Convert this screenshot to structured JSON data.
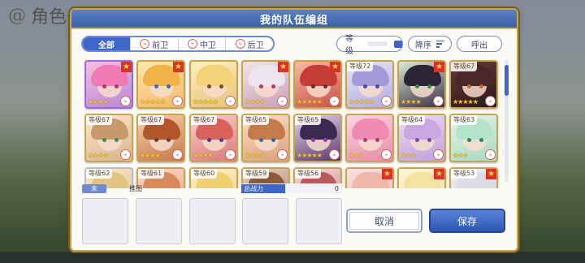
{
  "background": {
    "screen_title": "角色一览"
  },
  "dialog": {
    "title": "我的队伍编组"
  },
  "filter_tabs": [
    {
      "label": "全部",
      "icon": "",
      "active": true
    },
    {
      "label": "前卫",
      "icon": "front-position-icon",
      "active": false
    },
    {
      "label": "中卫",
      "icon": "middle-position-icon",
      "active": false
    },
    {
      "label": "后卫",
      "icon": "back-position-icon",
      "active": false
    }
  ],
  "sort": {
    "level_label": "等级",
    "order_label": "降序",
    "summon_label": "呼出"
  },
  "characters": [
    {
      "level": "",
      "badge": true,
      "stars": "★★★★",
      "c1": "#f4c0dc",
      "c2": "#b987d8",
      "hair": "#f07ab4",
      "eye": "#c0306e",
      "frame": "purple"
    },
    {
      "level": "",
      "badge": true,
      "stars": "★★★★★",
      "c1": "#ffe7b0",
      "c2": "#f3b76a",
      "hair": "#f1b24a",
      "eye": "#3a6bc0",
      "frame": "gold"
    },
    {
      "level": "",
      "badge": false,
      "stars": "★★★★★",
      "c1": "#fff0c2",
      "c2": "#e5c07a",
      "hair": "#f3d27a",
      "eye": "#7a4a2a",
      "frame": "gold"
    },
    {
      "level": "",
      "badge": true,
      "stars": "★★★★",
      "c1": "#f2e4ea",
      "c2": "#c9a0b6",
      "hair": "#ece4ee",
      "eye": "#b03a5a",
      "frame": "gold"
    },
    {
      "level": "",
      "badge": true,
      "stars": "★★★★★",
      "c1": "#f7b9a0",
      "c2": "#c8534a",
      "hair": "#c53b36",
      "eye": "#6a2a2a",
      "frame": "gold"
    },
    {
      "level": "等级72",
      "badge": false,
      "stars": "★★★★★",
      "c1": "#e7e4f6",
      "c2": "#b3aee0",
      "hair": "#a39ad9",
      "eye": "#4a4aa0",
      "frame": "gold"
    },
    {
      "level": "",
      "badge": true,
      "stars": "★★★★",
      "c1": "#d9e8d4",
      "c2": "#3b3348",
      "hair": "#2b2535",
      "eye": "#2f8a4a",
      "frame": "gold"
    },
    {
      "level": "等级67",
      "badge": false,
      "stars": "★★★★★",
      "c1": "#6a3a3a",
      "c2": "#2a1a1a",
      "hair": "#4a2626",
      "eye": "#c06a3a",
      "frame": "gold"
    },
    {
      "level": "等级67",
      "badge": false,
      "stars": "★★★★",
      "c1": "#fbe8d0",
      "c2": "#d8b48a",
      "hair": "#c8996a",
      "eye": "#3a8a5a",
      "frame": "gold"
    },
    {
      "level": "等级67",
      "badge": false,
      "stars": "★★★★",
      "c1": "#f8d0b0",
      "c2": "#c47a4a",
      "hair": "#b0562a",
      "eye": "#7a3a2a",
      "frame": "gold"
    },
    {
      "level": "等级67",
      "badge": false,
      "stars": "★★★★",
      "c1": "#fbd0d0",
      "c2": "#d87a7a",
      "hair": "#d9635a",
      "eye": "#5a3a8a",
      "frame": "gold"
    },
    {
      "level": "等级65",
      "badge": false,
      "stars": "★★★★",
      "c1": "#fbe0c8",
      "c2": "#d8a07a",
      "hair": "#c47b4a",
      "eye": "#3a6a9a",
      "frame": "gold"
    },
    {
      "level": "等级65",
      "badge": false,
      "stars": "★★★★★",
      "c1": "#e9d6f0",
      "c2": "#5a3a6a",
      "hair": "#3d2a52",
      "eye": "#9a3ab0",
      "frame": "gold"
    },
    {
      "level": "",
      "badge": false,
      "stars": "★★★",
      "c1": "#fbd6e4",
      "c2": "#e88aa8",
      "hair": "#f08ab0",
      "eye": "#b03a7a",
      "frame": "gold"
    },
    {
      "level": "等级64",
      "badge": false,
      "stars": "★★★",
      "c1": "#eadcf4",
      "c2": "#c0a0d8",
      "hair": "#caa7e0",
      "eye": "#7a4aa0",
      "frame": "gold"
    },
    {
      "level": "等级63",
      "badge": false,
      "stars": "★★★",
      "c1": "#e6f4ec",
      "c2": "#a8d8c0",
      "hair": "#b5e3c9",
      "eye": "#2a8a6a",
      "frame": "gold"
    },
    {
      "level": "等级62",
      "badge": false,
      "stars": "",
      "c1": "#f8e8c8",
      "c2": "#d8c090",
      "hair": "#e0c480",
      "eye": "#5a4a2a",
      "frame": "plain"
    },
    {
      "level": "等级61",
      "badge": false,
      "stars": "",
      "c1": "#fbd8c8",
      "c2": "#e0a080",
      "hair": "#d88a5a",
      "eye": "#5a3a2a",
      "frame": "gold"
    },
    {
      "level": "等级60",
      "badge": false,
      "stars": "",
      "c1": "#fff0c8",
      "c2": "#e8c880",
      "hair": "#f0cf70",
      "eye": "#5a4a2a",
      "frame": "gold"
    },
    {
      "level": "等级59",
      "badge": false,
      "stars": "",
      "c1": "#e8d0c0",
      "c2": "#a07a60",
      "hair": "#8a5a3a",
      "eye": "#5a3a2a",
      "frame": "gold"
    },
    {
      "level": "等级56",
      "badge": false,
      "stars": "",
      "c1": "#f8d8d8",
      "c2": "#c08080",
      "hair": "#b85a5a",
      "eye": "#5a2a2a",
      "frame": "gold"
    },
    {
      "level": "",
      "badge": true,
      "stars": "",
      "c1": "#fbe0e0",
      "c2": "#e8b0b0",
      "hair": "#f0b8a8",
      "eye": "#5a2a2a",
      "frame": "gold"
    },
    {
      "level": "",
      "badge": true,
      "stars": "",
      "c1": "#fff6d8",
      "c2": "#e8d8a0",
      "hair": "#f4e2a0",
      "eye": "#5a4a2a",
      "frame": "gold"
    },
    {
      "level": "等级53",
      "badge": true,
      "stars": "",
      "c1": "#f0f0f4",
      "c2": "#c8c8d4",
      "hair": "#dcdce6",
      "eye": "#3a3a5a",
      "frame": "gold"
    }
  ],
  "party": {
    "unset_label": "未",
    "name_label": "推图",
    "power_label": "总战力",
    "power_value": "0",
    "slot_count": 5
  },
  "buttons": {
    "cancel": "取消",
    "save": "保存"
  },
  "colors": {
    "accent": "#3e66c9",
    "frame_gold": "#c9a54a",
    "header": "#4a6fb8"
  }
}
